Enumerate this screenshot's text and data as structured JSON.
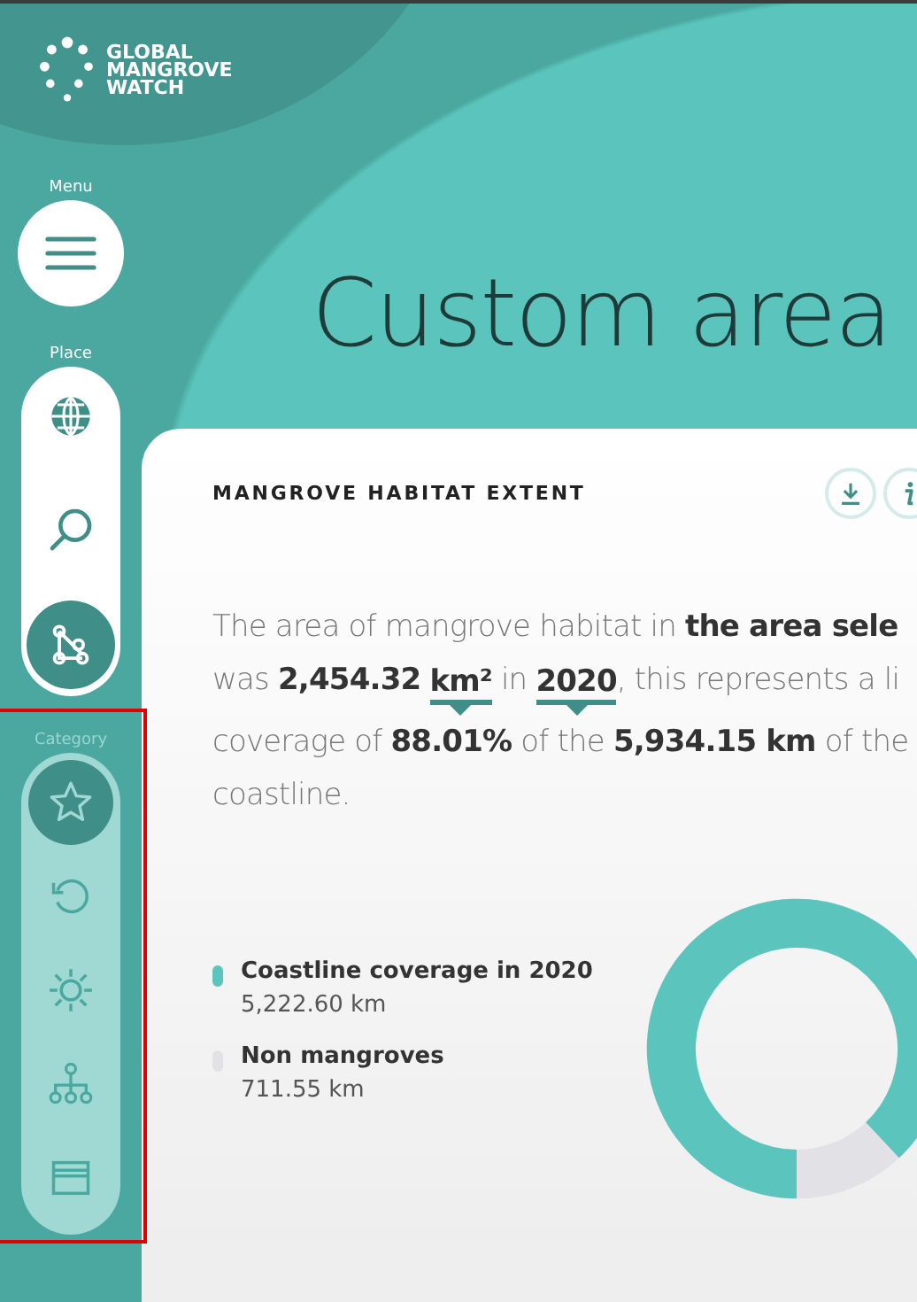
{
  "sidebar": {
    "logo_text": "GLOBAL MANGROVE WATCH",
    "menu": {
      "label": "Menu"
    },
    "place": {
      "label": "Place",
      "items": [
        {
          "kind": "globe",
          "selected": false
        },
        {
          "kind": "search",
          "selected": false
        },
        {
          "kind": "polygon",
          "selected": true
        }
      ]
    },
    "category": {
      "label": "Category",
      "highlighted": true,
      "items": [
        {
          "kind": "star",
          "selected": true
        },
        {
          "kind": "history",
          "selected": false
        },
        {
          "kind": "sun",
          "selected": false
        },
        {
          "kind": "hierarchy",
          "selected": false
        },
        {
          "kind": "layers",
          "selected": false
        }
      ]
    }
  },
  "title": "Custom area",
  "widget": {
    "title": "MANGROVE HABITAT EXTENT",
    "actions": [
      {
        "kind": "download"
      },
      {
        "kind": "info"
      }
    ],
    "summary": [
      [
        {
          "kind": "text",
          "text": "The area of mangrove habitat in **the area sele**"
        }
      ],
      [
        {
          "kind": "text",
          "text": "was **2,454.32** "
        },
        {
          "kind": "select",
          "text": "km²"
        },
        {
          "kind": "text",
          "text": " in "
        },
        {
          "kind": "select",
          "text": "2020"
        },
        {
          "kind": "text",
          "text": ", this represents a li"
        }
      ],
      [
        {
          "kind": "text",
          "text": "coverage of **88.01%** of the **5,934.15 km** of the"
        }
      ],
      [
        {
          "kind": "text",
          "text": "coastline."
        }
      ]
    ],
    "legend": [
      {
        "label": "Coastline coverage in 2020",
        "value": "5,222.60 km",
        "color": "#5bc5bd"
      },
      {
        "label": "Non mangroves",
        "value": "711.55 km",
        "color": "#e2e2e6"
      }
    ],
    "chart_data": {
      "type": "donut",
      "values": [
        88.01,
        11.99
      ],
      "colors": [
        "#5bc5bd",
        "#e2e2e6"
      ]
    }
  }
}
